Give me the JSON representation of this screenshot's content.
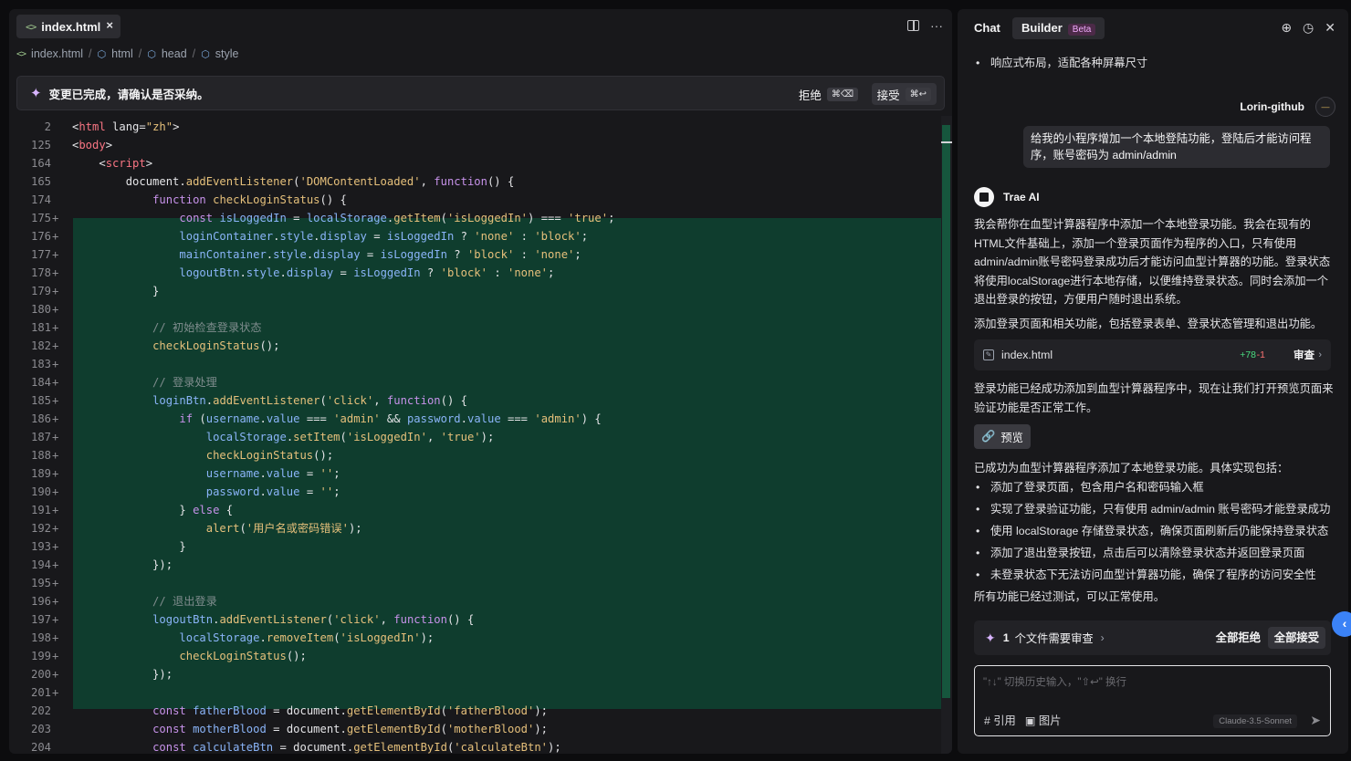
{
  "editor": {
    "tab_label": "index.html",
    "breadcrumb": [
      "index.html",
      "html",
      "head",
      "style"
    ],
    "notice": {
      "message": "变更已完成，请确认是否采纳。",
      "reject_label": "拒绝",
      "reject_kbd": "⌘⌫",
      "accept_label": "接受",
      "accept_kbd": "⌘↩"
    },
    "lines": [
      {
        "n": "2",
        "m": "",
        "added": false,
        "text": "<html lang=\"zh\">"
      },
      {
        "n": "125",
        "m": "",
        "added": false,
        "text": "<body>"
      },
      {
        "n": "164",
        "m": "",
        "added": false,
        "text": "    <script>"
      },
      {
        "n": "165",
        "m": "",
        "added": false,
        "text": "        document.addEventListener('DOMContentLoaded', function() {"
      },
      {
        "n": "174",
        "m": "",
        "added": false,
        "text": "            function checkLoginStatus() {"
      },
      {
        "n": "175",
        "m": "+",
        "added": true,
        "text": "                const isLoggedIn = localStorage.getItem('isLoggedIn') === 'true';"
      },
      {
        "n": "176",
        "m": "+",
        "added": true,
        "text": "                loginContainer.style.display = isLoggedIn ? 'none' : 'block';"
      },
      {
        "n": "177",
        "m": "+",
        "added": true,
        "text": "                mainContainer.style.display = isLoggedIn ? 'block' : 'none';"
      },
      {
        "n": "178",
        "m": "+",
        "added": true,
        "text": "                logoutBtn.style.display = isLoggedIn ? 'block' : 'none';"
      },
      {
        "n": "179",
        "m": "+",
        "added": true,
        "text": "            }"
      },
      {
        "n": "180",
        "m": "+",
        "added": true,
        "text": ""
      },
      {
        "n": "181",
        "m": "+",
        "added": true,
        "text": "            // 初始检查登录状态"
      },
      {
        "n": "182",
        "m": "+",
        "added": true,
        "text": "            checkLoginStatus();"
      },
      {
        "n": "183",
        "m": "+",
        "added": true,
        "text": ""
      },
      {
        "n": "184",
        "m": "+",
        "added": true,
        "text": "            // 登录处理"
      },
      {
        "n": "185",
        "m": "+",
        "added": true,
        "text": "            loginBtn.addEventListener('click', function() {"
      },
      {
        "n": "186",
        "m": "+",
        "added": true,
        "text": "                if (username.value === 'admin' && password.value === 'admin') {"
      },
      {
        "n": "187",
        "m": "+",
        "added": true,
        "text": "                    localStorage.setItem('isLoggedIn', 'true');"
      },
      {
        "n": "188",
        "m": "+",
        "added": true,
        "text": "                    checkLoginStatus();"
      },
      {
        "n": "189",
        "m": "+",
        "added": true,
        "text": "                    username.value = '';"
      },
      {
        "n": "190",
        "m": "+",
        "added": true,
        "text": "                    password.value = '';"
      },
      {
        "n": "191",
        "m": "+",
        "added": true,
        "text": "                } else {"
      },
      {
        "n": "192",
        "m": "+",
        "added": true,
        "text": "                    alert('用户名或密码错误');"
      },
      {
        "n": "193",
        "m": "+",
        "added": true,
        "text": "                }"
      },
      {
        "n": "194",
        "m": "+",
        "added": true,
        "text": "            });"
      },
      {
        "n": "195",
        "m": "+",
        "added": true,
        "text": ""
      },
      {
        "n": "196",
        "m": "+",
        "added": true,
        "text": "            // 退出登录"
      },
      {
        "n": "197",
        "m": "+",
        "added": true,
        "text": "            logoutBtn.addEventListener('click', function() {"
      },
      {
        "n": "198",
        "m": "+",
        "added": true,
        "text": "                localStorage.removeItem('isLoggedIn');"
      },
      {
        "n": "199",
        "m": "+",
        "added": true,
        "text": "                checkLoginStatus();"
      },
      {
        "n": "200",
        "m": "+",
        "added": true,
        "text": "            });"
      },
      {
        "n": "201",
        "m": "+",
        "added": true,
        "text": ""
      },
      {
        "n": "202",
        "m": "",
        "added": false,
        "text": "            const fatherBlood = document.getElementById('fatherBlood');"
      },
      {
        "n": "203",
        "m": "",
        "added": false,
        "text": "            const motherBlood = document.getElementById('motherBlood');"
      },
      {
        "n": "204",
        "m": "",
        "added": false,
        "text": "            const calculateBtn = document.getElementById('calculateBtn');"
      }
    ]
  },
  "chat": {
    "tab_chat": "Chat",
    "tab_builder": "Builder",
    "beta": "Beta",
    "top_bullet": "响应式布局，适配各种屏幕尺寸",
    "user_name": "Lorin-github",
    "user_avatar_text": "—",
    "user_message": "给我的小程序增加一个本地登陆功能，登陆后才能访问程序，账号密码为 admin/admin",
    "ai_name": "Trae AI",
    "ai_para1": "我会帮你在血型计算器程序中添加一个本地登录功能。我会在现有的HTML文件基础上，添加一个登录页面作为程序的入口，只有使用admin/admin账号密码登录成功后才能访问血型计算器的功能。登录状态将使用localStorage进行本地存储，以便维持登录状态。同时会添加一个退出登录的按钮，方便用户随时退出系统。",
    "ai_para2": "添加登录页面和相关功能，包括登录表单、登录状态管理和退出功能。",
    "file_card": {
      "name": "index.html",
      "added": "+78",
      "removed": "-1",
      "review": "审查"
    },
    "ai_para3": "登录功能已经成功添加到血型计算器程序中，现在让我们打开预览页面来验证功能是否正常工作。",
    "preview_label": "预览",
    "summary_intro": "已成功为血型计算器程序添加了本地登录功能。具体实现包括：",
    "summary_bullets": [
      "添加了登录页面，包含用户名和密码输入框",
      "实现了登录验证功能，只有使用 admin/admin 账号密码才能登录成功",
      "使用 localStorage 存储登录状态，确保页面刷新后仍能保持登录状态",
      "添加了退出登录按钮，点击后可以清除登录状态并返回登录页面",
      "未登录状态下无法访问血型计算器功能，确保了程序的访问安全性"
    ],
    "summary_outro": "所有功能已经过测试，可以正常使用。",
    "review_bar": {
      "count": "1",
      "label": "个文件需要审查",
      "reject_all": "全部拒绝",
      "accept_all": "全部接受"
    },
    "input": {
      "placeholder": "\"↑↓\" 切换历史输入，\"⇧↩\" 换行",
      "ref_label": "# 引用",
      "image_label": "图片",
      "model": "Claude-3.5-Sonnet"
    }
  },
  "colors": {
    "added_bg": "#0f3d2e",
    "accent": "#3b82f6"
  }
}
